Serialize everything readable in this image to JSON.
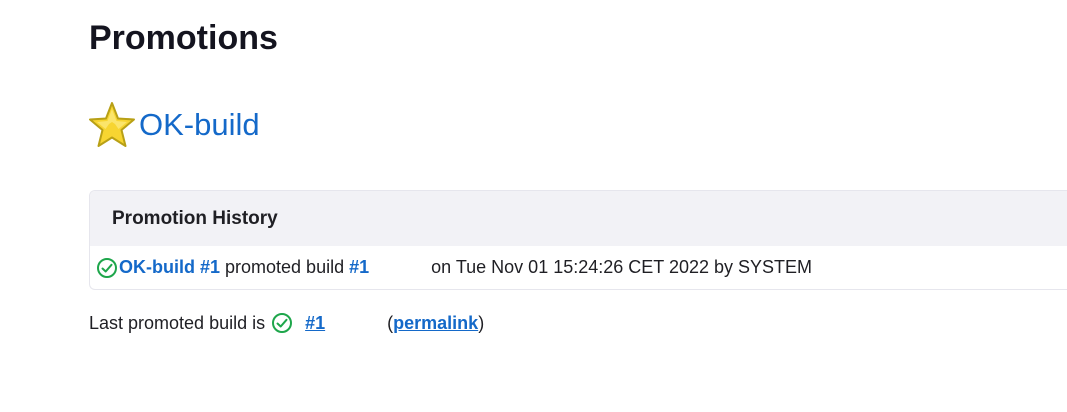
{
  "page": {
    "title": "Promotions"
  },
  "process": {
    "name": "OK-build",
    "icon": "star-icon"
  },
  "history": {
    "header": "Promotion History",
    "rows": [
      {
        "icon": "check-circle-icon",
        "process": "OK-build",
        "process_build": "#1",
        "promoted_text": "promoted build",
        "target_build": "#1",
        "details": "on Tue Nov 01 15:24:26 CET 2022 by SYSTEM"
      }
    ]
  },
  "last_promoted": {
    "text": "Last promoted build is",
    "icon": "check-circle-icon",
    "build": "#1",
    "paren_open": "(",
    "permalink": "permalink",
    "paren_close": ")"
  },
  "colors": {
    "link": "#1469c9",
    "success": "#1ea64b",
    "header_bg": "#f2f2f6",
    "star_fill": "#f7d531",
    "star_stroke": "#b8a016"
  }
}
